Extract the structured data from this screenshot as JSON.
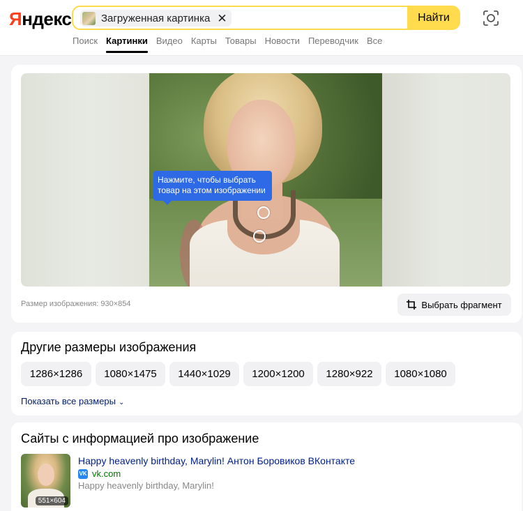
{
  "header": {
    "logo": "Яндекс",
    "logo_first_letter": "Я",
    "logo_rest": "ндекс",
    "search_chip_label": "Загруженная картинка",
    "chip_close_glyph": "✕",
    "find_button": "Найти",
    "lens_icon": "camera-lens-icon"
  },
  "tabs": [
    {
      "label": "Поиск",
      "active": false
    },
    {
      "label": "Картинки",
      "active": true
    },
    {
      "label": "Видео",
      "active": false
    },
    {
      "label": "Карты",
      "active": false
    },
    {
      "label": "Товары",
      "active": false
    },
    {
      "label": "Новости",
      "active": false
    },
    {
      "label": "Переводчик",
      "active": false
    },
    {
      "label": "Все",
      "active": false
    }
  ],
  "viewer": {
    "tooltip": "Нажмите, чтобы выбрать товар на этом изображении",
    "image_size_label": "Размер изображения: 930×854",
    "select_fragment_button": "Выбрать фрагмент"
  },
  "other_sizes": {
    "title": "Другие размеры изображения",
    "sizes": [
      "1286×1286",
      "1080×1475",
      "1440×1029",
      "1200×1200",
      "1280×922",
      "1080×1080"
    ],
    "show_all": "Показать все размеры"
  },
  "sites": {
    "title": "Сайты с информацией про изображение",
    "items": [
      {
        "title": "Happy heavenly birthday, Marylin! Антон Боровиков ВКонтакте",
        "domain": "vk.com",
        "description": "Happy heavenly birthday, Marylin!",
        "thumb_size": "551×604"
      }
    ]
  },
  "colors": {
    "accent": "#ffdb4d",
    "logo_red": "#fc3f1d",
    "tooltip_blue": "#2e69e6",
    "link_blue": "#001e8c",
    "domain_green": "#007700"
  }
}
